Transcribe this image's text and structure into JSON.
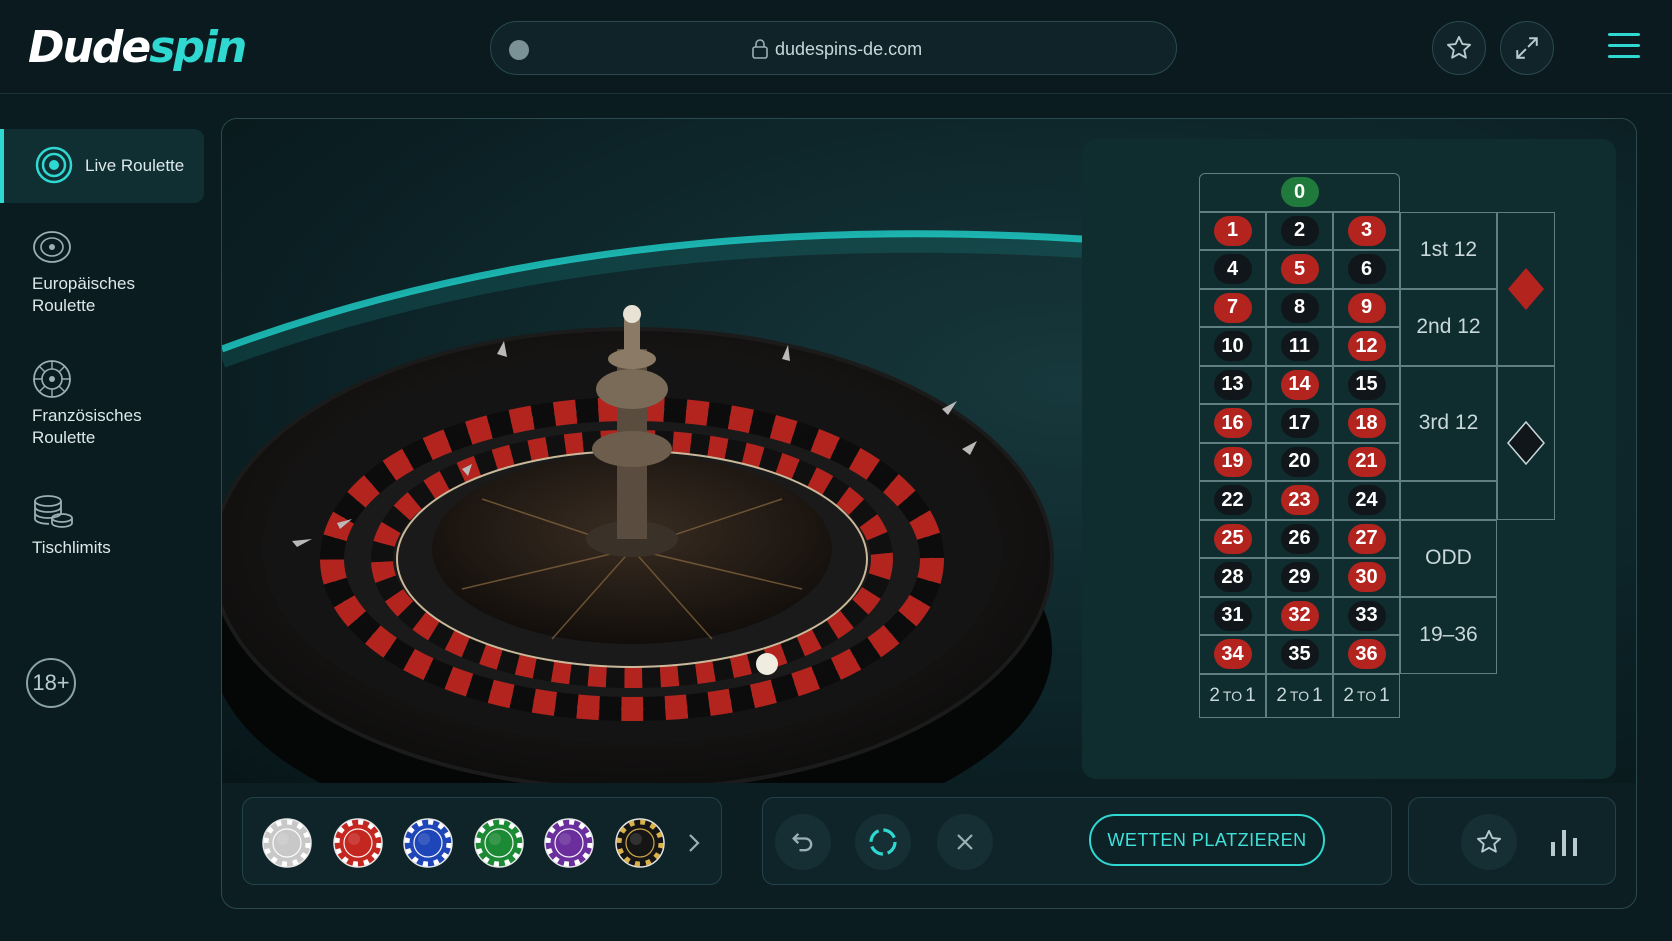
{
  "header": {
    "logo_part1": "Dude",
    "logo_part2": "spin",
    "url": "dudespins-de.com",
    "favorite_icon": "star-icon",
    "fullscreen_icon": "expand-icon",
    "menu_icon": "hamburger-icon"
  },
  "sidebar": {
    "items": [
      {
        "label": "Live Roulette",
        "icon": "target-icon",
        "active": true
      },
      {
        "label_line1": "Europäisches",
        "label_line2": "Roulette",
        "icon": "roulette-wheel-icon"
      },
      {
        "label_line1": "Französisches",
        "label_line2": "Roulette",
        "icon": "roulette-wheel-icon"
      },
      {
        "label": "Tischlimits",
        "icon": "coins-stack-icon"
      }
    ],
    "age_badge": "18+"
  },
  "board": {
    "zero": "0",
    "numbers": [
      [
        "1",
        "2",
        "3"
      ],
      [
        "4",
        "5",
        "6"
      ],
      [
        "7",
        "8",
        "9"
      ],
      [
        "10",
        "11",
        "12"
      ],
      [
        "13",
        "14",
        "15"
      ],
      [
        "16",
        "17",
        "18"
      ],
      [
        "19",
        "20",
        "21"
      ],
      [
        "22",
        "23",
        "24"
      ],
      [
        "25",
        "26",
        "27"
      ],
      [
        "28",
        "29",
        "30"
      ],
      [
        "31",
        "32",
        "33"
      ],
      [
        "34",
        "35",
        "36"
      ]
    ],
    "red_numbers": [
      1,
      3,
      5,
      7,
      9,
      12,
      14,
      16,
      18,
      19,
      21,
      23,
      25,
      27,
      30,
      32,
      34,
      36
    ],
    "dozens": [
      "1st 12",
      "2nd 12",
      "3rd 12"
    ],
    "outside": [
      "ODD",
      "19–36"
    ],
    "columns": [
      {
        "a": "2",
        "b": "TO",
        "c": "1"
      },
      {
        "a": "2",
        "b": "TO",
        "c": "1"
      },
      {
        "a": "2",
        "b": "TO",
        "c": "1"
      }
    ],
    "colors": {
      "red": "#b3241f",
      "black": "#101619",
      "green": "#1f7a3c"
    }
  },
  "chips": [
    {
      "color": "#c8c8c8",
      "name": "white"
    },
    {
      "color": "#c42620",
      "name": "red"
    },
    {
      "color": "#1f46b8",
      "name": "blue"
    },
    {
      "color": "#1c8a35",
      "name": "green"
    },
    {
      "color": "#6a2f9c",
      "name": "purple"
    },
    {
      "color": "#151515",
      "name": "black"
    }
  ],
  "controls": {
    "undo_icon": "undo-icon",
    "repeat_icon": "refresh-icon",
    "clear_icon": "close-icon",
    "place_bets_label": "WETTEN PLATZIEREN",
    "favorite_icon": "star-icon",
    "stats_icon": "bar-chart-icon"
  },
  "accent_color": "#2fd8d0"
}
